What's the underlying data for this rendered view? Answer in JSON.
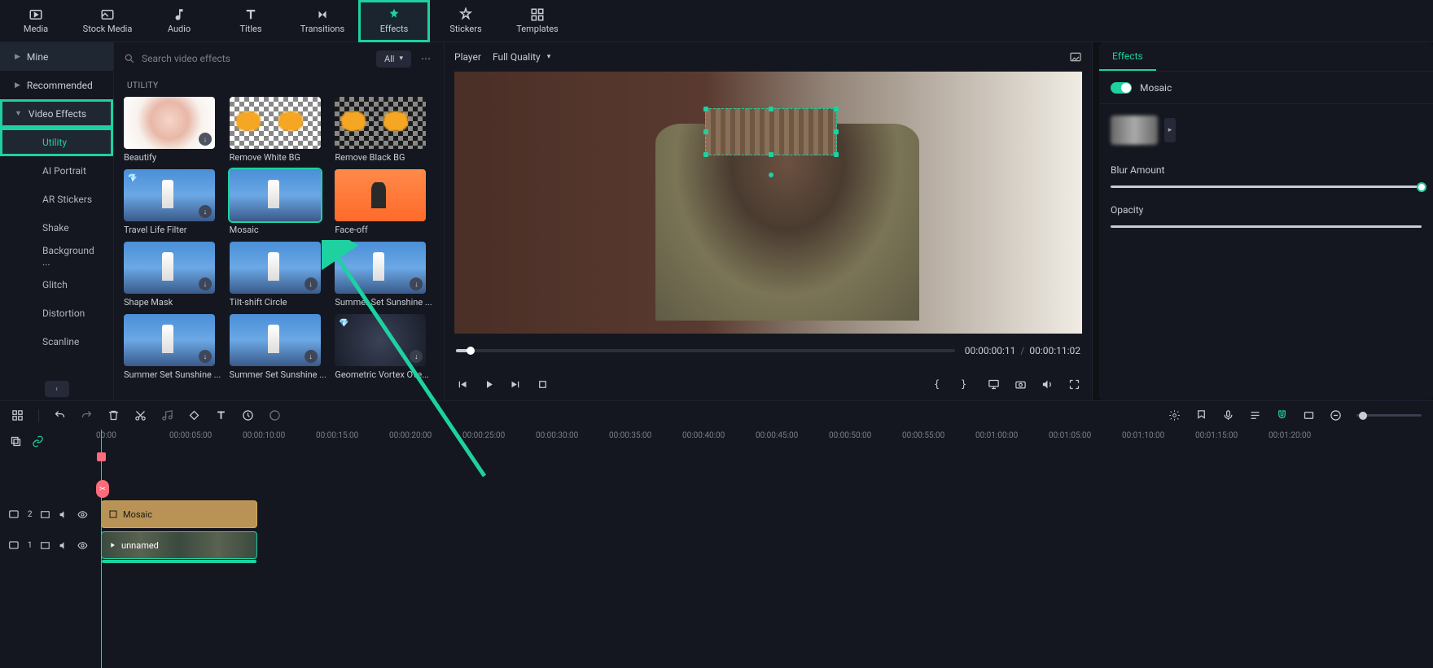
{
  "nav": {
    "items": [
      {
        "label": "Media"
      },
      {
        "label": "Stock Media"
      },
      {
        "label": "Audio"
      },
      {
        "label": "Titles"
      },
      {
        "label": "Transitions"
      },
      {
        "label": "Effects"
      },
      {
        "label": "Stickers"
      },
      {
        "label": "Templates"
      }
    ]
  },
  "sidebar": {
    "mine": "Mine",
    "recommended": "Recommended",
    "video_effects": "Video Effects",
    "items": [
      "Utility",
      "AI Portrait",
      "AR Stickers",
      "Shake",
      "Background ...",
      "Glitch",
      "Distortion",
      "Scanline"
    ]
  },
  "effects": {
    "search_placeholder": "Search video effects",
    "filter": "All",
    "section": "UTILITY",
    "cards": [
      {
        "name": "Beautify"
      },
      {
        "name": "Remove White BG"
      },
      {
        "name": "Remove Black BG"
      },
      {
        "name": "Travel Life Filter"
      },
      {
        "name": "Mosaic"
      },
      {
        "name": "Face-off"
      },
      {
        "name": "Shape Mask"
      },
      {
        "name": "Tilt-shift Circle"
      },
      {
        "name": "Summer Set Sunshine ..."
      },
      {
        "name": "Summer Set Sunshine ..."
      },
      {
        "name": "Summer Set Sunshine ..."
      },
      {
        "name": "Geometric Vortex Ove..."
      }
    ]
  },
  "player": {
    "label": "Player",
    "quality": "Full Quality",
    "current_time": "00:00:00:11",
    "total_time": "00:00:11:02"
  },
  "inspector": {
    "tab": "Effects",
    "effect_name": "Mosaic",
    "blur_label": "Blur Amount",
    "opacity_label": "Opacity"
  },
  "timeline": {
    "marks": [
      "00:00",
      "00:00:05:00",
      "00:00:10:00",
      "00:00:15:00",
      "00:00:20:00",
      "00:00:25:00",
      "00:00:30:00",
      "00:00:35:00",
      "00:00:40:00",
      "00:00:45:00",
      "00:00:50:00",
      "00:00:55:00",
      "00:01:00:00",
      "00:01:05:00",
      "00:01:10:00",
      "00:01:15:00",
      "00:01:20:00"
    ],
    "track2_badge": "2",
    "track1_badge": "1",
    "fx_clip": "Mosaic",
    "vid_clip": "unnamed"
  }
}
